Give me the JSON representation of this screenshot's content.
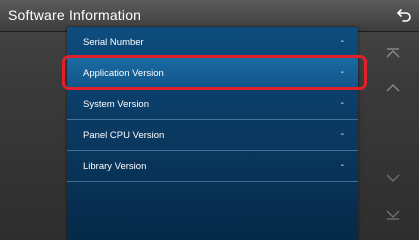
{
  "header": {
    "title": "Software Information"
  },
  "list": {
    "items": [
      {
        "label": "Serial Number",
        "value": "-"
      },
      {
        "label": "Application Version",
        "value": "-"
      },
      {
        "label": "System Version",
        "value": "-"
      },
      {
        "label": "Panel CPU Version",
        "value": "-"
      },
      {
        "label": "Library Version",
        "value": "-"
      }
    ],
    "selected_index": 1
  },
  "icons": {
    "back": "back-arrow-icon",
    "scroll_top": "scroll-to-top-icon",
    "scroll_up": "scroll-up-icon",
    "scroll_down": "scroll-down-icon",
    "scroll_bottom": "scroll-to-bottom-icon"
  },
  "colors": {
    "list_blue": "#0d4d7e",
    "highlight_red": "#e0202a",
    "header_gray": "#4a4a4a"
  }
}
